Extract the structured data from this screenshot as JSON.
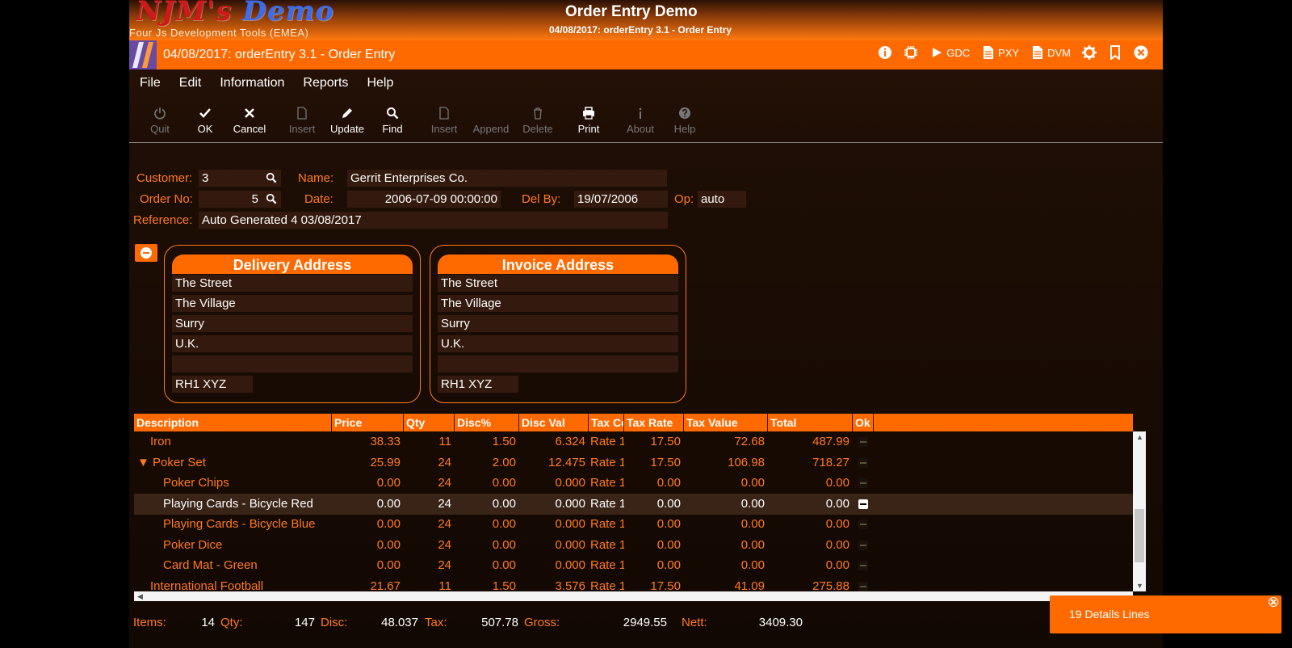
{
  "header": {
    "logo_main": "NJM's",
    "logo_demo": "Demo",
    "logo_sub": "Four Js Development Tools (EMEA)",
    "title": "Order Entry Demo",
    "subtitle": "04/08/2017: orderEntry 3.1 - Order Entry"
  },
  "window": {
    "title": "04/08/2017: orderEntry 3.1 - Order Entry",
    "icons": [
      {
        "name": "info-icon",
        "label": ""
      },
      {
        "name": "chip-icon",
        "label": ""
      },
      {
        "name": "play-icon",
        "label": "GDC"
      },
      {
        "name": "doc-icon",
        "label": "PXY"
      },
      {
        "name": "doc-icon",
        "label": "DVM"
      },
      {
        "name": "gear-icon",
        "label": ""
      },
      {
        "name": "bookmark-icon",
        "label": ""
      },
      {
        "name": "close-icon",
        "label": ""
      }
    ]
  },
  "menu": [
    "File",
    "Edit",
    "Information",
    "Reports",
    "Help"
  ],
  "toolbar": {
    "quit": "Quit",
    "ok": "OK",
    "cancel": "Cancel",
    "insert1": "Insert",
    "update": "Update",
    "find": "Find",
    "insert2": "Insert",
    "append": "Append",
    "delete": "Delete",
    "print": "Print",
    "about": "About",
    "help": "Help"
  },
  "form": {
    "customer_label": "Customer:",
    "customer": "3",
    "name_label": "Name:",
    "name": "Gerrit Enterprises Co.",
    "order_label": "Order No:",
    "order": "5",
    "date_label": "Date:",
    "date": "2006-07-09 00:00:00",
    "delby_label": "Del By:",
    "delby": "19/07/2006",
    "op_label": "Op:",
    "op": "auto",
    "reference_label": "Reference:",
    "reference": "Auto Generated 4 03/08/2017"
  },
  "delivery": {
    "title": "Delivery Address",
    "lines": [
      "The Street",
      "The Village",
      "Surry",
      "U.K.",
      ""
    ],
    "postcode": "RH1 XYZ"
  },
  "invoice": {
    "title": "Invoice Address",
    "lines": [
      "The Street",
      "The Village",
      "Surry",
      "U.K.",
      ""
    ],
    "postcode": "RH1 XYZ"
  },
  "table": {
    "columns": [
      "Description",
      "Price",
      "Qty",
      "Disc%",
      "Disc Val",
      "Tax Code",
      "Tax Rate",
      "Tax Value",
      "Total",
      "Ok"
    ],
    "rows": [
      {
        "desc": "Iron",
        "level": 1,
        "price": "38.33",
        "qty": "11",
        "disc": "1.50",
        "discval": "6.324",
        "taxcode": "Rate 1",
        "taxrate": "17.50",
        "taxval": "72.68",
        "total": "487.99",
        "selected": false
      },
      {
        "desc": "▼ Poker Set",
        "level": 0,
        "price": "25.99",
        "qty": "24",
        "disc": "2.00",
        "discval": "12.475",
        "taxcode": "Rate 1",
        "taxrate": "17.50",
        "taxval": "106.98",
        "total": "718.27",
        "selected": false
      },
      {
        "desc": "Poker Chips",
        "level": 2,
        "price": "0.00",
        "qty": "24",
        "disc": "0.00",
        "discval": "0.000",
        "taxcode": "Rate 1",
        "taxrate": "0.00",
        "taxval": "0.00",
        "total": "0.00",
        "selected": false
      },
      {
        "desc": "Playing Cards - Bicycle Red",
        "level": 2,
        "price": "0.00",
        "qty": "24",
        "disc": "0.00",
        "discval": "0.000",
        "taxcode": "Rate 1",
        "taxrate": "0.00",
        "taxval": "0.00",
        "total": "0.00",
        "selected": true
      },
      {
        "desc": "Playing Cards - Bicycle Blue",
        "level": 2,
        "price": "0.00",
        "qty": "24",
        "disc": "0.00",
        "discval": "0.000",
        "taxcode": "Rate 1",
        "taxrate": "0.00",
        "taxval": "0.00",
        "total": "0.00",
        "selected": false
      },
      {
        "desc": "Poker Dice",
        "level": 2,
        "price": "0.00",
        "qty": "24",
        "disc": "0.00",
        "discval": "0.000",
        "taxcode": "Rate 1",
        "taxrate": "0.00",
        "taxval": "0.00",
        "total": "0.00",
        "selected": false
      },
      {
        "desc": "Card Mat - Green",
        "level": 2,
        "price": "0.00",
        "qty": "24",
        "disc": "0.00",
        "discval": "0.000",
        "taxcode": "Rate 1",
        "taxrate": "0.00",
        "taxval": "0.00",
        "total": "0.00",
        "selected": false
      },
      {
        "desc": "International Football",
        "level": 1,
        "price": "21.67",
        "qty": "11",
        "disc": "1.50",
        "discval": "3.576",
        "taxcode": "Rate 1",
        "taxrate": "17.50",
        "taxval": "41.09",
        "total": "275.88",
        "selected": false
      }
    ]
  },
  "totals": {
    "items_label": "Items:",
    "items": "14",
    "qty_label": "Qty:",
    "qty": "147",
    "disc_label": "Disc:",
    "disc": "48.037",
    "tax_label": "Tax:",
    "tax": "507.78",
    "gross_label": "Gross:",
    "gross": "2949.55",
    "nett_label": "Nett:",
    "nett": "3409.30"
  },
  "toast": {
    "text": "19 Details Lines"
  },
  "colors": {
    "accent": "#ff6a00",
    "label": "#ff7a1a",
    "field_bg": "#341a0e",
    "background": "#1e0e05"
  }
}
